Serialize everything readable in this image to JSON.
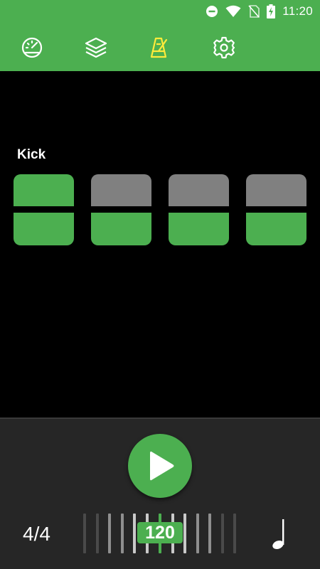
{
  "status_bar": {
    "time": "11:20",
    "icons": [
      "do-not-disturb-icon",
      "wifi-icon",
      "no-sim-icon",
      "battery-charging-icon"
    ]
  },
  "nav_tabs": [
    {
      "name": "speedometer-icon",
      "active": false
    },
    {
      "name": "layers-icon",
      "active": false
    },
    {
      "name": "metronome-icon",
      "active": true
    },
    {
      "name": "settings-icon",
      "active": false
    }
  ],
  "colors": {
    "accent": "#4caf50",
    "active_icon": "#ffeb3b",
    "pad_off": "#808080",
    "panel": "#262626"
  },
  "track": {
    "label": "Kick",
    "beats": [
      {
        "accent": true
      },
      {
        "accent": false
      },
      {
        "accent": false
      },
      {
        "accent": false
      }
    ]
  },
  "controls": {
    "time_signature": "4/4",
    "bpm": "120",
    "play_icon": "play-icon",
    "note_icon": "quarter-note-icon"
  }
}
